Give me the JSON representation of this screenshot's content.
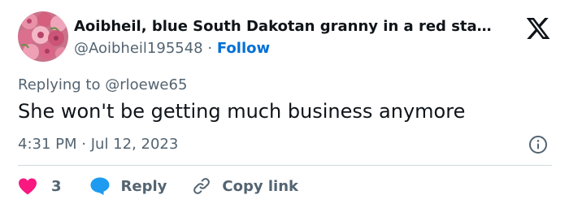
{
  "author": {
    "display_name": "Aoibheil, blue South Dakotan granny in a red sta…",
    "handle": "@Aoibheil195548",
    "separator": "·",
    "follow_label": "Follow"
  },
  "tweet": {
    "replying_prefix": "Replying to ",
    "replying_handle": "@rloewe65",
    "text": "She won't be getting much business anymore",
    "time": "4:31 PM",
    "separator": "·",
    "date": "Jul 12, 2023"
  },
  "actions": {
    "like_count": "3",
    "reply_label": "Reply",
    "copy_link_label": "Copy link"
  },
  "colors": {
    "text_primary": "#0f1419",
    "text_secondary": "#536471",
    "link_blue": "#006fd6",
    "heart_red": "#f91880",
    "reply_blue": "#1d9bf0",
    "divider": "#cfd9de"
  },
  "icons": [
    "avatar-rose-bouquet",
    "x-logo-icon",
    "info-icon",
    "heart-icon",
    "reply-bubble-icon",
    "link-icon"
  ]
}
